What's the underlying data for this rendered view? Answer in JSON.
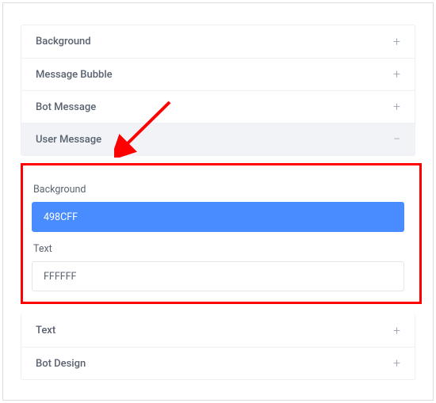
{
  "accordion": {
    "items": [
      {
        "label": "Background",
        "expanded": false
      },
      {
        "label": "Message Bubble",
        "expanded": false
      },
      {
        "label": "Bot Message",
        "expanded": false
      },
      {
        "label": "User Message",
        "expanded": true
      }
    ],
    "bottom_items": [
      {
        "label": "Text",
        "expanded": false
      },
      {
        "label": "Bot Design",
        "expanded": false
      }
    ]
  },
  "user_message": {
    "background_label": "Background",
    "background_value": "498CFF",
    "text_label": "Text",
    "text_value": "FFFFFF"
  },
  "icons": {
    "plus": "+",
    "minus": "−"
  }
}
